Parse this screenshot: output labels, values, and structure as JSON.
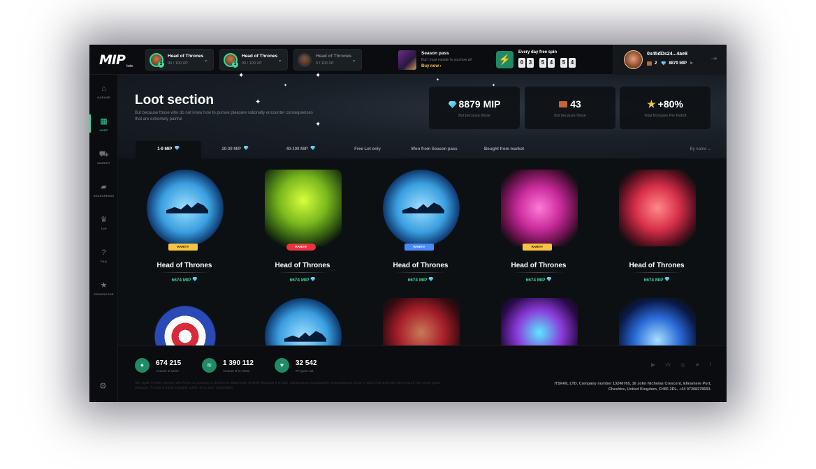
{
  "logo": {
    "text": "MIP",
    "tag": "beta"
  },
  "top_heroes": [
    {
      "name": "Head of Thrones",
      "xp": "90 / 100 XP",
      "level": "2"
    },
    {
      "name": "Head of Thrones",
      "xp": "90 / 100 XP",
      "level": "1"
    },
    {
      "name": "Head of Thrones",
      "xp": "0 / 100 XP",
      "level": ""
    }
  ],
  "season_pass": {
    "title": "Season pass",
    "desc": "But I must explain to you how all",
    "cta": "Buy now"
  },
  "free_spin": {
    "title": "Every day free spin",
    "digits": [
      "0",
      "3",
      "5",
      "4",
      "5",
      "4"
    ]
  },
  "profile": {
    "address": "0x45dDs24...4ae8",
    "crates": "2",
    "mip": "8879 MIP"
  },
  "sidebar": [
    {
      "icon": "garage-icon",
      "glyph": "⌂",
      "label": "GARAGE"
    },
    {
      "icon": "loot-icon",
      "glyph": "▦",
      "label": "LOOT"
    },
    {
      "icon": "market-icon",
      "glyph": "⛟",
      "label": "MARKET"
    },
    {
      "icon": "seasonpass-icon",
      "glyph": "▰",
      "label": "SEASONPASS"
    },
    {
      "icon": "crown-icon",
      "glyph": "♛",
      "label": "TOP"
    },
    {
      "icon": "faq-icon",
      "glyph": "?",
      "label": "FAQ"
    },
    {
      "icon": "star-icon",
      "glyph": "★",
      "label": "PROMOCODE"
    }
  ],
  "header": {
    "title": "Loot section",
    "subtitle": "But because those who do not know how to pursue pleasure rationally encounter consequences that are extremely painful"
  },
  "stats": [
    {
      "value": "8879 MIP",
      "label": "But because those"
    },
    {
      "value": "43",
      "label": "But because those"
    },
    {
      "value": "+80%",
      "label": "Total Bonuses Per Robot"
    }
  ],
  "tabs": [
    "1-9 MIP",
    "20-39 MIP",
    "40-100 MIP",
    "Free Lot only",
    "Won from Season pass",
    "Bought from market"
  ],
  "sort_label": "By name",
  "cards": [
    {
      "name": "Head of Thrones",
      "price": "6674 MIP",
      "rarity": "RARITY"
    },
    {
      "name": "Head of Thrones",
      "price": "6674 MIP",
      "rarity": "RARITY"
    },
    {
      "name": "Head of Thrones",
      "price": "6674 MIP",
      "rarity": "RARITY"
    },
    {
      "name": "Head of Thrones",
      "price": "6674 MIP",
      "rarity": "RARITY"
    },
    {
      "name": "Head of Thrones",
      "price": "6674 MIP",
      "rarity": ""
    }
  ],
  "footer": {
    "stats": [
      {
        "value": "674 215",
        "label": "Amount of users"
      },
      {
        "value": "1 390 112",
        "label": "Amount of re-mints"
      },
      {
        "value": "32 542",
        "label": "XP given out"
      }
    ],
    "note": "Nor again is there anyone who loves or pursues or desires to obtain pain of itself, because it is pain, but because occasionally circumstances occur in which toil and pain can procure him some great pleasure. To take a trivial example, which of us ever undertakes",
    "corp": "ITSFAIL LTD. Company number 13246765, 16 John Nicholas Crescent, Ellesmere Port, Cheshire, United Kingdom, CH65 2DL, +44 07308278693.",
    "socials": [
      "youtube-icon",
      "vk-icon",
      "instagram-icon",
      "telegram-icon",
      "facebook-icon"
    ]
  },
  "colors": {
    "accent": "#3ad69a",
    "gold": "#f5c542",
    "red": "#e8363f",
    "blue": "#4a8aff"
  }
}
